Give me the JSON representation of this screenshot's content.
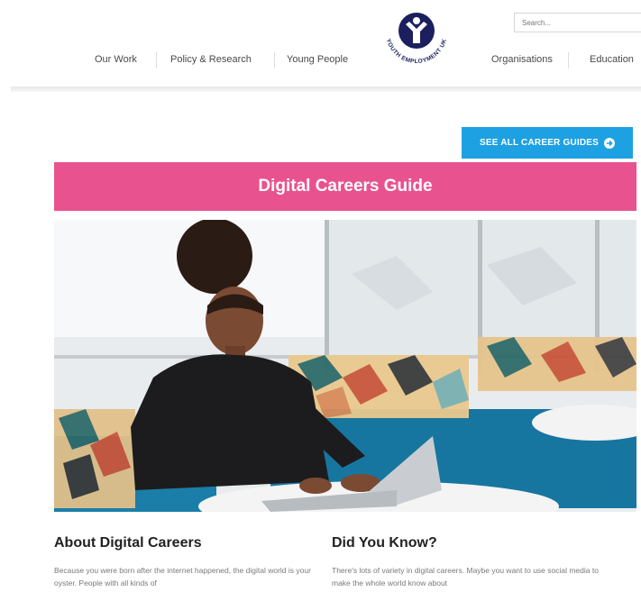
{
  "header": {
    "nav_left": [
      "Our Work",
      "Policy & Research",
      "Young People"
    ],
    "nav_right": [
      "Organisations",
      "Education"
    ],
    "logo_text": "YOUTH EMPLOYMENT UK",
    "search_placeholder": "Search..."
  },
  "cta": {
    "label": "SEE ALL CAREER GUIDES",
    "icon": "arrow-circle-right-icon"
  },
  "banner": {
    "title": "Digital Careers Guide"
  },
  "hero": {
    "image": "young-woman-typing-on-laptop"
  },
  "sections": [
    {
      "heading": "About Digital Careers",
      "text": "Because you were born after the internet happened, the digital world is your oyster. People with all kinds of"
    },
    {
      "heading": "Did You Know?",
      "text": "There's lots of variety in digital careers. Maybe you want to use social media to make the whole world know about"
    }
  ],
  "colors": {
    "accent_blue": "#1da1e2",
    "banner_pink": "#e8538f",
    "logo_navy": "#1b1f5e"
  }
}
